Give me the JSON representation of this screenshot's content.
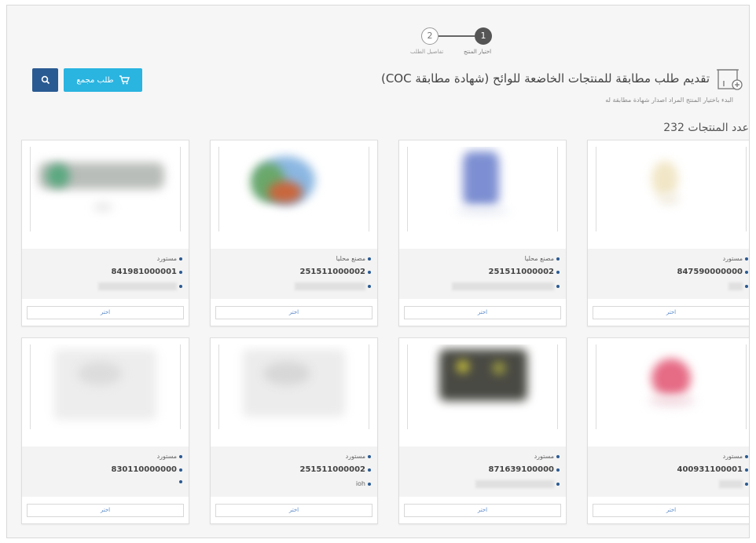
{
  "stepper": {
    "steps": [
      {
        "number": "1",
        "label": "اختيار المنتج",
        "active": true
      },
      {
        "number": "2",
        "label": "تفاصيل الطلب",
        "active": false
      }
    ]
  },
  "header": {
    "title": "تقديم طلب مطابقة للمنتجات الخاضعة للوائح (شهادة مطابقة COC)",
    "subtitle": "البدء باختيار المنتج المراد اصدار شهادة مطابقة له",
    "count_label": "عدد المنتجات 232",
    "bulk_button_label": "طلب مجمع"
  },
  "icons": {
    "document": "document-add-icon",
    "cart": "cart-icon",
    "search": "search-icon"
  },
  "colors": {
    "bulk_button": "#2ab4e0",
    "search_button": "#2a5a92",
    "bullet": "#2a5a92"
  },
  "products": [
    {
      "origin": "مستورد",
      "code": "847590000000",
      "extra": "",
      "select_label": "اختر"
    },
    {
      "origin": "مصنع محليا",
      "code": "251511000002",
      "extra": "",
      "select_label": "اختر"
    },
    {
      "origin": "مصنع محليا",
      "code": "251511000002",
      "extra": "",
      "select_label": "اختر"
    },
    {
      "origin": "مستورد",
      "code": "841981000001",
      "extra": "",
      "select_label": "اختر"
    },
    {
      "origin": "مستورد",
      "code": "400931100001",
      "extra": "",
      "select_label": "اختر"
    },
    {
      "origin": "مستورد",
      "code": "871639100000",
      "extra": "",
      "select_label": "اختر"
    },
    {
      "origin": "مستورد",
      "code": "251511000002",
      "extra": "ioh",
      "select_label": "اختر"
    },
    {
      "origin": "مستورد",
      "code": "830110000000",
      "extra": "",
      "select_label": "اختر"
    }
  ]
}
